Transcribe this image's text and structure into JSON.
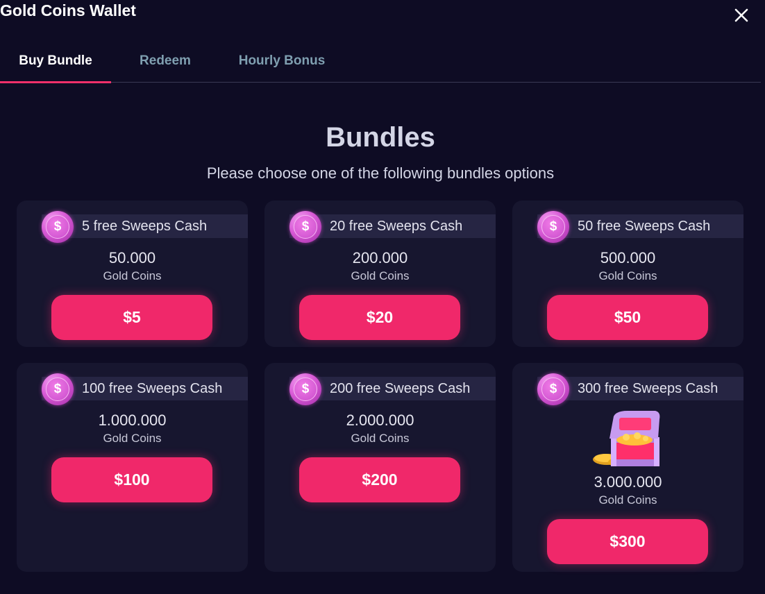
{
  "window": {
    "title": "Gold Coins Wallet"
  },
  "tabs": [
    {
      "label": "Buy Bundle",
      "active": true
    },
    {
      "label": "Redeem",
      "active": false
    },
    {
      "label": "Hourly Bonus",
      "active": false
    }
  ],
  "main": {
    "heading": "Bundles",
    "subheading": "Please choose one of the following bundles options"
  },
  "bundles": [
    {
      "badge": "5 free Sweeps Cash",
      "amount": "50.000",
      "unit": "Gold Coins",
      "price": "$5"
    },
    {
      "badge": "20 free Sweeps Cash",
      "amount": "200.000",
      "unit": "Gold Coins",
      "price": "$20"
    },
    {
      "badge": "50 free Sweeps Cash",
      "amount": "500.000",
      "unit": "Gold Coins",
      "price": "$50"
    },
    {
      "badge": "100 free Sweeps Cash",
      "amount": "1.000.000",
      "unit": "Gold Coins",
      "price": "$100"
    },
    {
      "badge": "200 free Sweeps Cash",
      "amount": "2.000.000",
      "unit": "Gold Coins",
      "price": "$200"
    },
    {
      "badge": "300 free Sweeps Cash",
      "amount": "3.000.000",
      "unit": "Gold Coins",
      "price": "$300"
    }
  ],
  "coin_symbol": "$",
  "icons": {
    "close": "close-icon",
    "coin": "sweeps-coin-icon",
    "chest": "treasure-chest-icon"
  },
  "colors": {
    "background": "#0e0c24",
    "card": "#17162f",
    "accent": "#f0286a",
    "inactive_tab": "#7f9fb0",
    "coin": "#d85ad6"
  }
}
